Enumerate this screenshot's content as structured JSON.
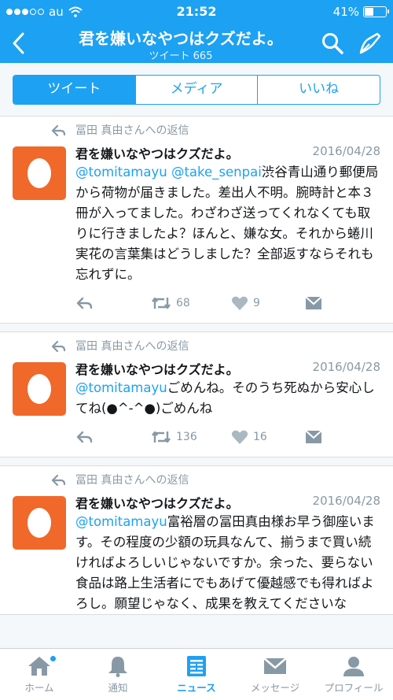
{
  "status": {
    "carrier": "au",
    "time": "21:52",
    "battery": "41%",
    "battery_level": 0.41
  },
  "nav": {
    "title": "君を嫌いなやつはクズだよ。",
    "subtitle": "ツイート 665"
  },
  "segments": [
    {
      "label": "ツイート",
      "active": true
    },
    {
      "label": "メディア",
      "active": false
    },
    {
      "label": "いいね",
      "active": false
    }
  ],
  "tweets": [
    {
      "context": "冨田 真由さんへの返信",
      "author": "君を嫌いなやつはクズだよ。",
      "date": "2016/04/28",
      "mention": "@tomitamayu @take_senpai",
      "text": "渋谷青山通り郵便局から荷物が届きました。差出人不明。腕時計と本３冊が入ってました。わざわざ送ってくれなくても取りに行きましたよ？ほんと、嫌な女。それから蜷川実花の言葉集はどうしました？全部返すならそれも忘れずに。",
      "retweets": "68",
      "likes": "9"
    },
    {
      "context": "冨田 真由さんへの返信",
      "author": "君を嫌いなやつはクズだよ。",
      "date": "2016/04/28",
      "mention": "@tomitamayu",
      "text": "ごめんね。そのうち死ぬから安心してね(●^-^●)ごめんね",
      "retweets": "136",
      "likes": "16"
    },
    {
      "context": "冨田 真由さんへの返信",
      "author": "君を嫌いなやつはクズだよ。",
      "date": "2016/04/28",
      "mention": "@tomitamayu",
      "text": "富裕層の冨田真由様お早う御座います。その程度の少額の玩具なんて、揃うまで買い続ければよろしいじゃないですか。余った、要らない食品は路上生活者にでもあげて優越感でも得ればよろし。願望じゃなく、成果を教えてくださいな",
      "retweets": "",
      "likes": ""
    }
  ],
  "tabbar": {
    "home": "ホーム",
    "notifications": "通知",
    "news": "ニュース",
    "messages": "メッセージ",
    "profile": "プロフィール"
  },
  "colors": {
    "accent": "#1da1f2",
    "avatar": "#f0682a",
    "muted": "#8899a6"
  }
}
